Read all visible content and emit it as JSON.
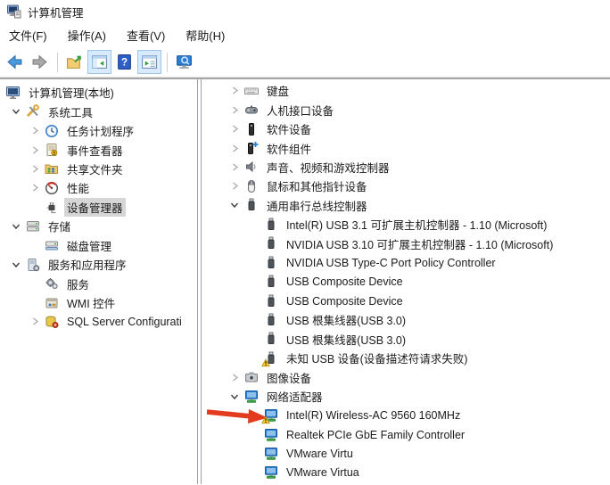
{
  "window": {
    "title": "计算机管理",
    "icon": "computer-management-icon"
  },
  "menu": {
    "items": [
      "文件(F)",
      "操作(A)",
      "查看(V)",
      "帮助(H)"
    ]
  },
  "toolbar": {
    "items": [
      {
        "type": "button",
        "name": "back",
        "icon": "back-arrow-icon",
        "pressed": false
      },
      {
        "type": "button",
        "name": "forward",
        "icon": "forward-arrow-icon",
        "pressed": false
      },
      {
        "type": "separator"
      },
      {
        "type": "button",
        "name": "up-level",
        "icon": "folder-up-icon",
        "pressed": false
      },
      {
        "type": "button",
        "name": "show-console-tree",
        "icon": "console-tree-window-icon",
        "pressed": true
      },
      {
        "type": "button",
        "name": "help",
        "icon": "help-icon",
        "pressed": false
      },
      {
        "type": "button",
        "name": "show-action-pane",
        "icon": "action-pane-window-icon",
        "pressed": true
      },
      {
        "type": "separator"
      },
      {
        "type": "button",
        "name": "console-view",
        "icon": "monitor-search-icon",
        "pressed": false
      }
    ]
  },
  "left_tree": {
    "items": [
      {
        "label": "计算机管理(本地)",
        "icon": "computer-icon",
        "level": 0,
        "expand": "none",
        "root": true,
        "selected": false
      },
      {
        "label": "系统工具",
        "icon": "tools-icon",
        "level": 1,
        "expand": "expanded",
        "root": false,
        "selected": false
      },
      {
        "label": "任务计划程序",
        "icon": "task-scheduler-icon",
        "level": 2,
        "expand": "collapsed",
        "root": false,
        "selected": false
      },
      {
        "label": "事件查看器",
        "icon": "event-viewer-icon",
        "level": 2,
        "expand": "collapsed",
        "root": false,
        "selected": false
      },
      {
        "label": "共享文件夹",
        "icon": "shared-folder-icon",
        "level": 2,
        "expand": "collapsed",
        "root": false,
        "selected": false
      },
      {
        "label": "性能",
        "icon": "performance-icon",
        "level": 2,
        "expand": "collapsed",
        "root": false,
        "selected": false
      },
      {
        "label": "设备管理器",
        "icon": "device-manager-icon",
        "level": 2,
        "expand": "none",
        "root": false,
        "selected": true
      },
      {
        "label": "存储",
        "icon": "storage-icon",
        "level": 1,
        "expand": "expanded",
        "root": false,
        "selected": false
      },
      {
        "label": "磁盘管理",
        "icon": "disk-management-icon",
        "level": 2,
        "expand": "none",
        "root": false,
        "selected": false
      },
      {
        "label": "服务和应用程序",
        "icon": "services-apps-icon",
        "level": 1,
        "expand": "expanded",
        "root": false,
        "selected": false
      },
      {
        "label": "服务",
        "icon": "services-icon",
        "level": 2,
        "expand": "none",
        "root": false,
        "selected": false
      },
      {
        "label": "WMI 控件",
        "icon": "wmi-icon",
        "level": 2,
        "expand": "none",
        "root": false,
        "selected": false
      },
      {
        "label": "SQL Server Configurati",
        "icon": "sql-server-icon",
        "level": 2,
        "expand": "collapsed",
        "root": false,
        "selected": false
      }
    ]
  },
  "right_tree": {
    "items": [
      {
        "label": "键盘",
        "icon": "keyboard-icon",
        "level": 0,
        "expand": "collapsed"
      },
      {
        "label": "人机接口设备",
        "icon": "hid-icon",
        "level": 0,
        "expand": "collapsed"
      },
      {
        "label": "软件设备",
        "icon": "software-device-icon",
        "level": 0,
        "expand": "collapsed"
      },
      {
        "label": "软件组件",
        "icon": "software-component-icon",
        "level": 0,
        "expand": "collapsed"
      },
      {
        "label": "声音、视频和游戏控制器",
        "icon": "audio-icon",
        "level": 0,
        "expand": "collapsed"
      },
      {
        "label": "鼠标和其他指针设备",
        "icon": "mouse-icon",
        "level": 0,
        "expand": "collapsed"
      },
      {
        "label": "通用串行总线控制器",
        "icon": "usb-icon",
        "level": 0,
        "expand": "expanded"
      },
      {
        "label": "Intel(R) USB 3.1 可扩展主机控制器 - 1.10 (Microsoft)",
        "icon": "usb-icon",
        "level": 1,
        "expand": "none"
      },
      {
        "label": "NVIDIA USB 3.10 可扩展主机控制器 - 1.10 (Microsoft)",
        "icon": "usb-icon",
        "level": 1,
        "expand": "none"
      },
      {
        "label": "NVIDIA USB Type-C Port Policy Controller",
        "icon": "usb-icon",
        "level": 1,
        "expand": "none"
      },
      {
        "label": "USB Composite Device",
        "icon": "usb-icon",
        "level": 1,
        "expand": "none"
      },
      {
        "label": "USB Composite Device",
        "icon": "usb-icon",
        "level": 1,
        "expand": "none"
      },
      {
        "label": "USB 根集线器(USB 3.0)",
        "icon": "usb-icon",
        "level": 1,
        "expand": "none"
      },
      {
        "label": "USB 根集线器(USB 3.0)",
        "icon": "usb-icon",
        "level": 1,
        "expand": "none"
      },
      {
        "label": "未知 USB 设备(设备描述符请求失败)",
        "icon": "usb-warning-icon",
        "level": 1,
        "expand": "none"
      },
      {
        "label": "图像设备",
        "icon": "imaging-icon",
        "level": 0,
        "expand": "collapsed"
      },
      {
        "label": "网络适配器",
        "icon": "network-icon",
        "level": 0,
        "expand": "expanded"
      },
      {
        "label": "Intel(R) Wireless-AC 9560 160MHz",
        "icon": "network-warning-icon",
        "level": 1,
        "expand": "none",
        "annotated": true
      },
      {
        "label": "Realtek PCIe GbE Family Controller",
        "icon": "network-icon",
        "level": 1,
        "expand": "none"
      },
      {
        "label": "VMware Virtu",
        "icon": "network-icon",
        "level": 1,
        "expand": "none"
      },
      {
        "label": "VMware Virtua",
        "icon": "network-icon",
        "level": 1,
        "expand": "none"
      }
    ]
  },
  "colors": {
    "selection_bg": "#d6d6d6",
    "toolbar_pressed_bg": "#d8eafc",
    "toolbar_pressed_border": "#9cc5e8",
    "warning_yellow": "#fdc928",
    "annotation_red": "#e23b1e",
    "network_blue": "#2a7fd4",
    "network_green": "#3fae49",
    "pane_border": "#9aa0a6"
  }
}
